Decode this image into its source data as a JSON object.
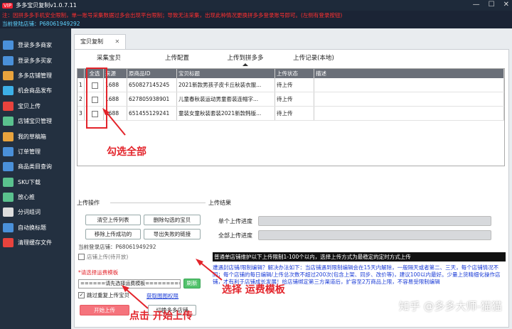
{
  "window": {
    "vip_badge": "VIP",
    "title": "多多宝贝复制v1.0.7.11",
    "ctrl_min": "—",
    "ctrl_max": "☐",
    "ctrl_close": "✕"
  },
  "notice": "注：因拼多多手机安全限制，单一账号采集数据过多会出现平台限制；导致无法采集，出现此种情况更换拼多多登录账号即可。(左侧有登录按钮)",
  "shop_label": "当前登陆店铺：P68061949292",
  "sidebar": [
    {
      "label": "登录多多商家",
      "icon": "monitor-icon",
      "color": "#4a90d9"
    },
    {
      "label": "登录多多买家",
      "icon": "monitor-icon",
      "color": "#4a90d9"
    },
    {
      "label": "多多店铺管理",
      "icon": "store-icon",
      "color": "#e8a33d"
    },
    {
      "label": "机会商品发布",
      "icon": "publish-icon",
      "color": "#3db0e8"
    },
    {
      "label": "宝贝上传",
      "icon": "upload-icon",
      "color": "#e8433d"
    },
    {
      "label": "店铺宝贝管理",
      "icon": "manage-icon",
      "color": "#5ac18e"
    },
    {
      "label": "我的草稿箱",
      "icon": "draft-icon",
      "color": "#e8a33d"
    },
    {
      "label": "订单管理",
      "icon": "order-icon",
      "color": "#4a90d9"
    },
    {
      "label": "商品类目查询",
      "icon": "category-icon",
      "color": "#4a90d9"
    },
    {
      "label": "SKU下载",
      "icon": "download-icon",
      "color": "#5ac18e"
    },
    {
      "label": "放心推",
      "icon": "promote-icon",
      "color": "#5ac18e"
    },
    {
      "label": "分词组词",
      "icon": "tool-icon",
      "color": "#dddddd"
    },
    {
      "label": "自动换标题",
      "icon": "title-icon",
      "color": "#4a90d9"
    },
    {
      "label": "清理缓存文件",
      "icon": "clean-icon",
      "color": "#e8433d"
    }
  ],
  "tabs": {
    "main": "宝贝复制",
    "close": "✕"
  },
  "subnav": [
    "采集宝贝",
    "上传配置",
    "上传到拼多多",
    "上传记录(本地)"
  ],
  "grid": {
    "headers": [
      "全选",
      "来源",
      "原商品ID",
      "宝贝标题",
      "上传状态",
      "描述"
    ],
    "rows": [
      {
        "idx": "1",
        "src": "1688",
        "id": "650827145245",
        "title": "2021新款男孩子皮卡丘秋装衣服...",
        "status": "待上传"
      },
      {
        "idx": "2",
        "src": "1688",
        "id": "627805938901",
        "title": "儿童春秋装运动男童套装连帽字...",
        "status": "待上传"
      },
      {
        "idx": "3",
        "src": "1688",
        "id": "651455129241",
        "title": "童装女童秋装套装2021新款韩版...",
        "status": "待上传"
      }
    ]
  },
  "upload_ops": {
    "title": "上传操作",
    "btn_clear": "清空上传列表",
    "btn_del_checked": "删除勾选的宝贝",
    "btn_move_success": "移除上传成功的",
    "btn_export_fail": "导出失败的链接",
    "shop_line": "当前登录店铺：P68061949292",
    "chk_shop_upload": "店铺上传(待开放)",
    "template_label": "*请选择运费模板",
    "template_select": "======请先选择运费模板=========",
    "btn_refresh": "刷新",
    "chk_skip_dup": "跳过重复上传宝贝",
    "link_gallery": "获取图图权限",
    "btn_start": "开始上传",
    "btn_switch": "切换多多店铺"
  },
  "result": {
    "title": "上传结果",
    "single_label": "单个上传进度",
    "all_label": "全部上传进度",
    "black_note": "普通单店铺维护以下上传限制1-100个以内，选择上传方式为最稳定的定时方式上传",
    "blue_note": "遭遇封店铺/限制编辑？解决办法如下：当店铺遇到限制编辑会在15天内解除，一般隔天或者第二、三天，每个店铺情况不同；每个店铺的每日编辑/上传总次数不超过200次(包含上架、同步、改价等)，建议100以内最好。少量上货精细化操作店铺，才有利于店铺成长发展！给店铺绑定第三方渠道后，扩容至2万商品上限，不容易受限制编辑"
  },
  "annotations": {
    "select_all": "勾选全部",
    "select_template": "选择 运费模板",
    "click_start": "点击 开始上传"
  },
  "watermark": "知乎 @多多大师-猫猫"
}
